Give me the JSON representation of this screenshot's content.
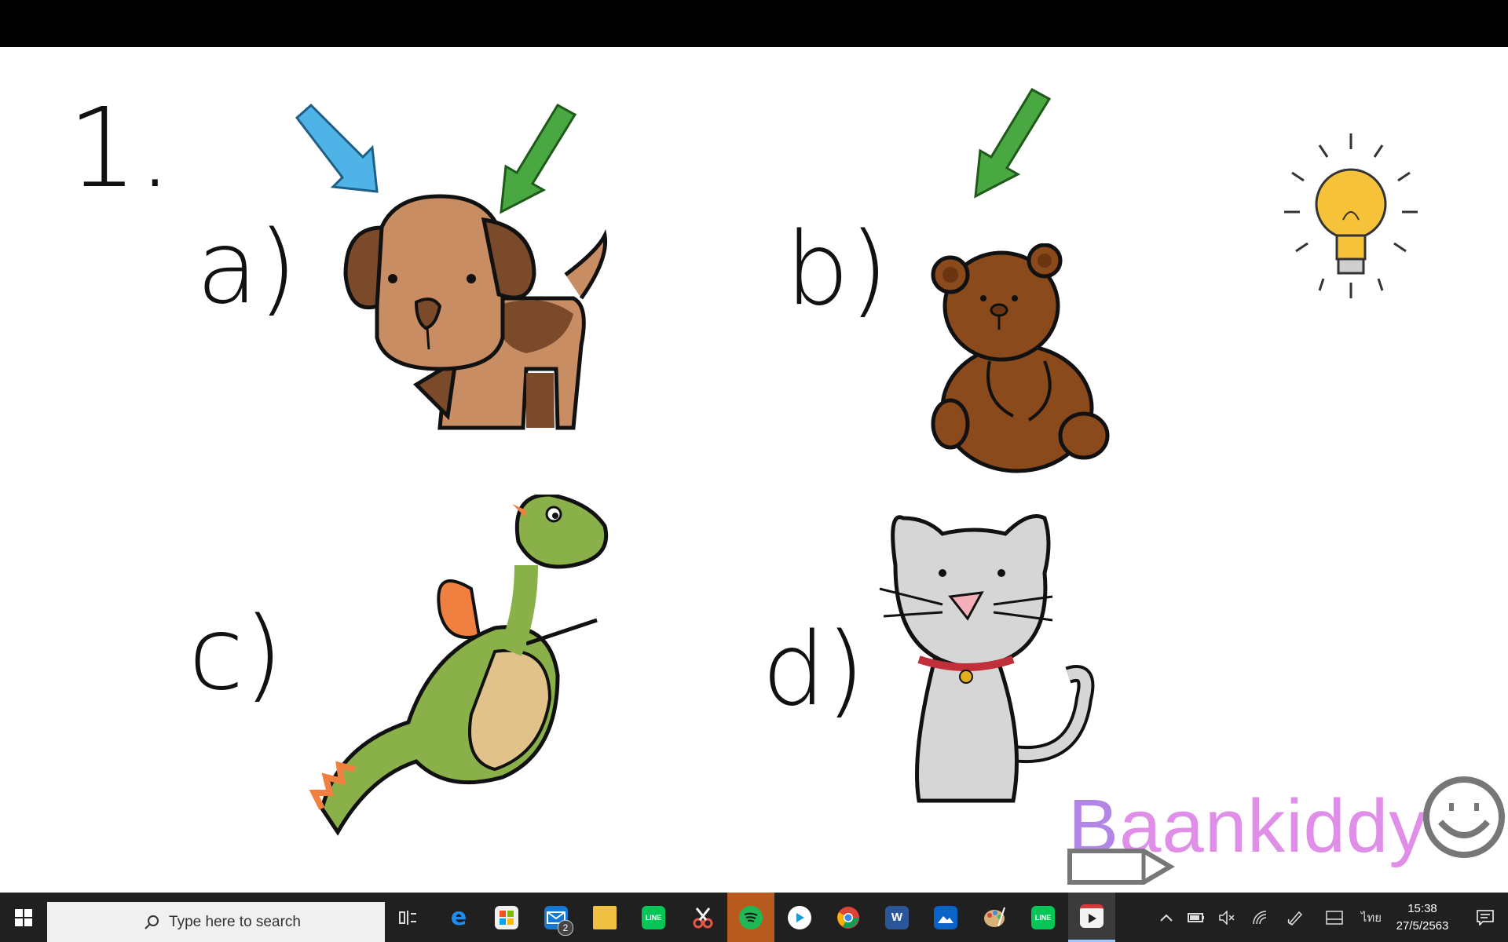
{
  "slide": {
    "question_number": "1.",
    "options": [
      {
        "letter": "a)",
        "animal": "dog"
      },
      {
        "letter": "b)",
        "animal": "bear"
      },
      {
        "letter": "c)",
        "animal": "dragon"
      },
      {
        "letter": "d)",
        "animal": "cat"
      }
    ],
    "brand": {
      "first_letter": "B",
      "rest": "aankiddy"
    }
  },
  "taskbar": {
    "search_placeholder": "Type here to search",
    "apps": [
      {
        "name": "Task View",
        "icon": "task-view-icon"
      },
      {
        "name": "Microsoft Edge",
        "icon": "edge-icon"
      },
      {
        "name": "Microsoft Store",
        "icon": "store-icon"
      },
      {
        "name": "Mail",
        "icon": "mail-icon",
        "badge": "2"
      },
      {
        "name": "File Explorer",
        "icon": "folder-icon"
      },
      {
        "name": "LINE",
        "icon": "line-icon",
        "label": "LINE"
      },
      {
        "name": "Snip & Sketch",
        "icon": "snip-icon"
      },
      {
        "name": "Spotify",
        "icon": "spotify-icon"
      },
      {
        "name": "Video Player",
        "icon": "play-circle-icon"
      },
      {
        "name": "Google Chrome",
        "icon": "chrome-icon"
      },
      {
        "name": "Microsoft Word",
        "icon": "word-icon",
        "label": "W"
      },
      {
        "name": "Photos",
        "icon": "photos-icon"
      },
      {
        "name": "Paint 3D",
        "icon": "paint-icon"
      },
      {
        "name": "LINE",
        "icon": "line-icon",
        "label": "LINE"
      },
      {
        "name": "Video Editor",
        "icon": "video-editor-icon",
        "active": true
      }
    ],
    "tray": {
      "language": "ไทย",
      "time": "15:38",
      "date": "27/5/2563"
    }
  },
  "colors": {
    "taskbar_bg": "#202020",
    "slide_bg": "#ffffff",
    "arrow_blue": "#4fb3e8",
    "arrow_green": "#4aa842",
    "brand_pink": "#e08fe8"
  }
}
